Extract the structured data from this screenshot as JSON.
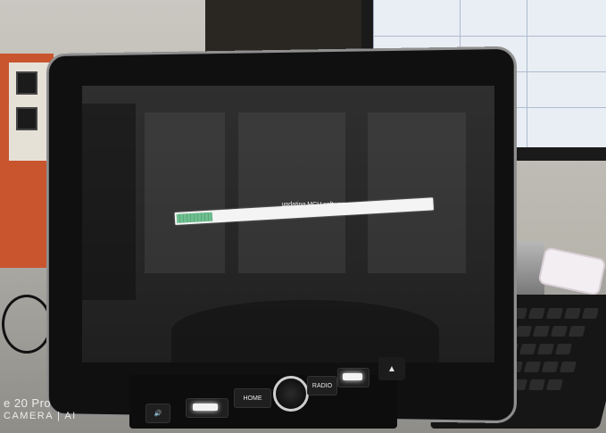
{
  "screen": {
    "message": "updating MCU software...",
    "progress_fraction": 0.14
  },
  "head_unit": {
    "home_label": "HOME",
    "radio_label": "RADIO",
    "eject_symbol": "▲",
    "voice_symbol": "🔊"
  },
  "watermark": {
    "line1": "e 20 Pro",
    "line2": "CAMERA | AI"
  },
  "colors": {
    "progress_fill": "#6fbe8f",
    "progress_track": "#f4f4f4",
    "screen_bg": "#2a2a2a"
  }
}
